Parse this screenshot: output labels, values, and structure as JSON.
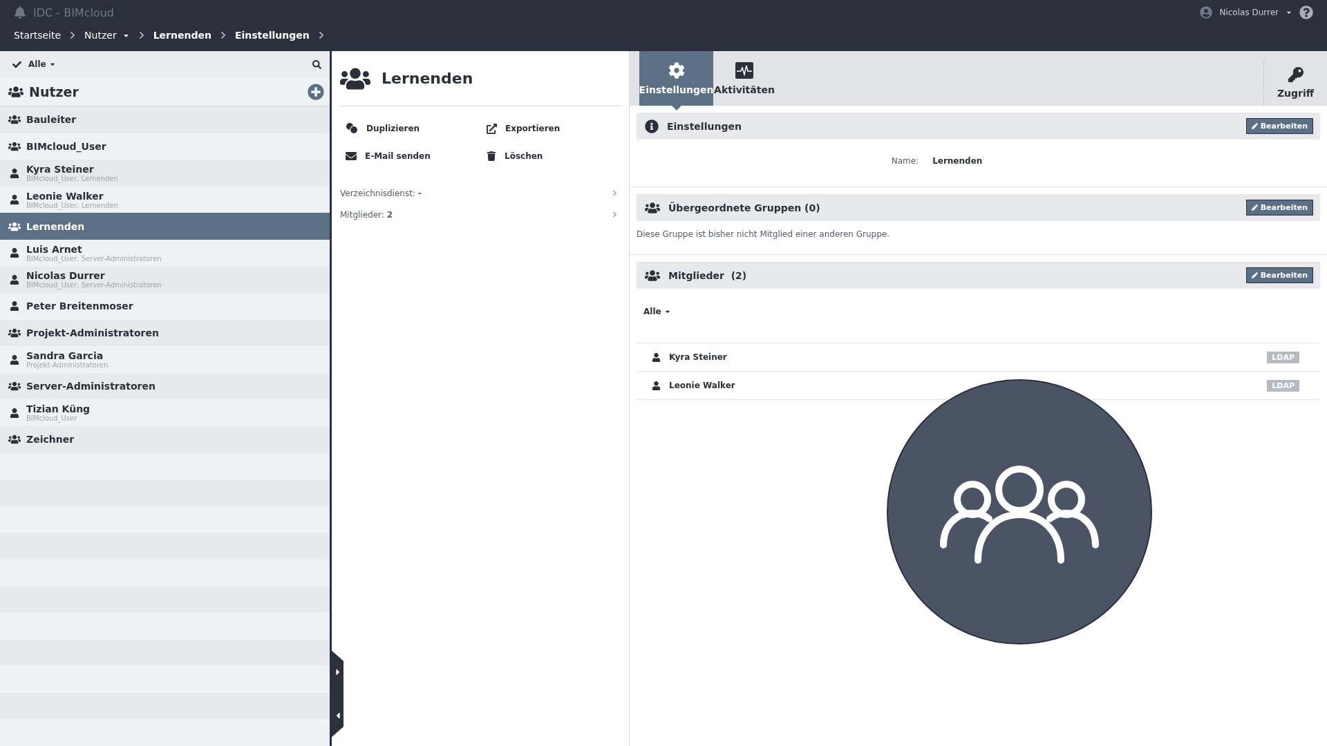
{
  "header": {
    "title": "IDC - BIMcloud",
    "user": "Nicolas Durrer"
  },
  "breadcrumb": [
    {
      "label": "Startseite",
      "current": false,
      "dropdown": false
    },
    {
      "label": "Nutzer",
      "current": false,
      "dropdown": true
    },
    {
      "label": "Lernenden",
      "current": true,
      "dropdown": false
    },
    {
      "label": "Einstellungen",
      "current": true,
      "dropdown": false
    }
  ],
  "sidebar": {
    "filter": "Alle",
    "title": "Nutzer",
    "items": [
      {
        "kind": "group",
        "name": "Bauleiter",
        "selected": false
      },
      {
        "kind": "group",
        "name": "BIMcloud_User",
        "selected": false
      },
      {
        "kind": "user",
        "name": "Kyra Steiner",
        "groups": "BIMcloud_User, Lernenden",
        "selected": false
      },
      {
        "kind": "user",
        "name": "Leonie Walker",
        "groups": "BIMcloud_User, Lernenden",
        "selected": false
      },
      {
        "kind": "group",
        "name": "Lernenden",
        "selected": true
      },
      {
        "kind": "user",
        "name": "Luis Arnet",
        "groups": "BIMcloud_User, Server-Administratoren",
        "selected": false
      },
      {
        "kind": "user",
        "name": "Nicolas Durrer",
        "groups": "BIMcloud_User, Server-Administratoren",
        "selected": false
      },
      {
        "kind": "user",
        "name": "Peter Breitenmoser",
        "selected": false
      },
      {
        "kind": "group",
        "name": "Projekt-Administratoren",
        "selected": false
      },
      {
        "kind": "user",
        "name": "Sandra Garcia",
        "groups": "Projekt-Administratoren",
        "selected": false
      },
      {
        "kind": "group",
        "name": "Server-Administratoren",
        "selected": false
      },
      {
        "kind": "user",
        "name": "Tizian Küng",
        "groups": "BIMcloud_User",
        "selected": false
      },
      {
        "kind": "group",
        "name": "Zeichner",
        "selected": false
      }
    ]
  },
  "detail": {
    "title": "Lernenden",
    "actions": [
      {
        "kind": "duplicate",
        "label": "Duplizieren"
      },
      {
        "kind": "export",
        "label": "Exportieren"
      },
      {
        "kind": "email",
        "label": "E-Mail senden"
      },
      {
        "kind": "delete",
        "label": "Löschen"
      }
    ],
    "info": [
      {
        "label": "Verzeichnisdienst:",
        "value": "-"
      },
      {
        "label": "Mitglieder:",
        "value": "2"
      }
    ]
  },
  "tabs": [
    {
      "kind": "settings",
      "label": "Einstellungen",
      "selected": true
    },
    {
      "kind": "activity",
      "label": "Aktivitäten",
      "selected": false
    }
  ],
  "access": "Zugriff",
  "settings": {
    "title": "Einstellungen",
    "edit": "Bearbeiten",
    "fields": [
      {
        "label": "Name:",
        "value": "Lernenden"
      }
    ]
  },
  "parents": {
    "title": "Übergeordnete Gruppen (0)",
    "edit": "Bearbeiten",
    "note": "Diese Gruppe ist bisher nicht Mitglied einer anderen Gruppe."
  },
  "members": {
    "title": "Mitglieder",
    "count": "(2)",
    "edit": "Bearbeiten",
    "filter": "Alle",
    "rows": [
      {
        "name": "Kyra Steiner",
        "tag": "LDAP"
      },
      {
        "name": "Leonie Walker",
        "tag": "LDAP"
      }
    ]
  }
}
